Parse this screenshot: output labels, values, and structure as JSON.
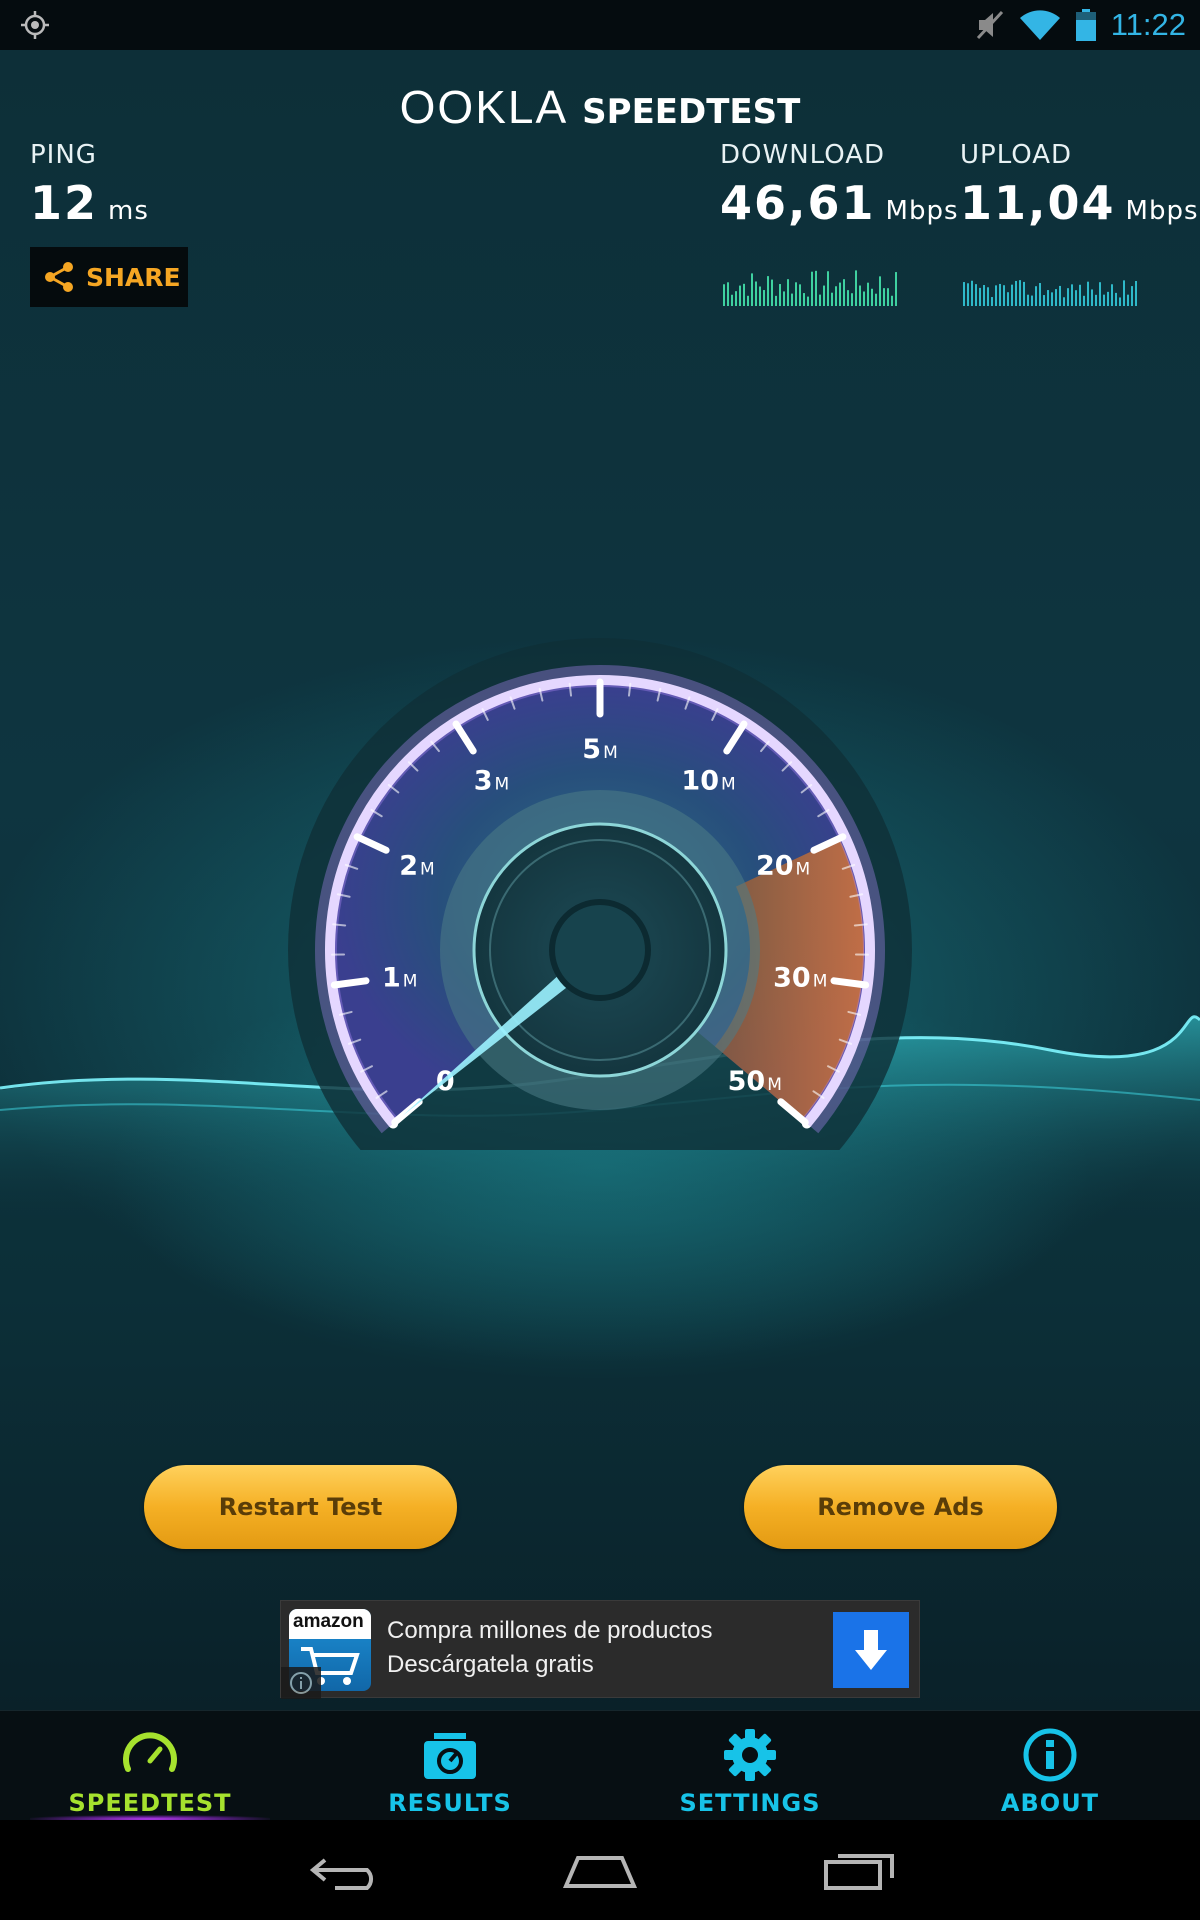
{
  "status_bar": {
    "time": "11:22",
    "icons": [
      "location-icon",
      "mute-icon",
      "wifi-icon",
      "battery-icon"
    ]
  },
  "header": {
    "brand": "OOKLA",
    "product": "SPEEDTEST"
  },
  "ping": {
    "label": "PING",
    "value": "12",
    "unit": "ms"
  },
  "download": {
    "label": "DOWNLOAD",
    "value": "46,61",
    "unit": "Mbps"
  },
  "upload": {
    "label": "UPLOAD",
    "value": "11,04",
    "unit": "Mbps"
  },
  "share": {
    "label": "SHARE"
  },
  "gauge": {
    "scale_labels": [
      "0",
      "1",
      "2",
      "3",
      "5",
      "10",
      "20",
      "30",
      "50"
    ],
    "unit_suffix": "M",
    "reading_mbps": 0
  },
  "buttons": {
    "restart": "Restart Test",
    "remove_ads": "Remove Ads"
  },
  "ad": {
    "brand": "amazon",
    "line1": "Compra millones de productos",
    "line2": "Descárgatela gratis"
  },
  "nav": {
    "active": "speedtest",
    "items": [
      {
        "id": "speedtest",
        "label": "SPEEDTEST",
        "icon": "speedometer-icon"
      },
      {
        "id": "results",
        "label": "RESULTS",
        "icon": "results-icon"
      },
      {
        "id": "settings",
        "label": "SETTINGS",
        "icon": "gear-icon"
      },
      {
        "id": "about",
        "label": "ABOUT",
        "icon": "info-icon"
      }
    ]
  },
  "colors": {
    "accent_cyan": "#17c3e8",
    "active_green": "#a6e22e",
    "share_orange": "#f5a623",
    "button_gold": "#f5b025",
    "status_blue": "#33b5e5"
  }
}
